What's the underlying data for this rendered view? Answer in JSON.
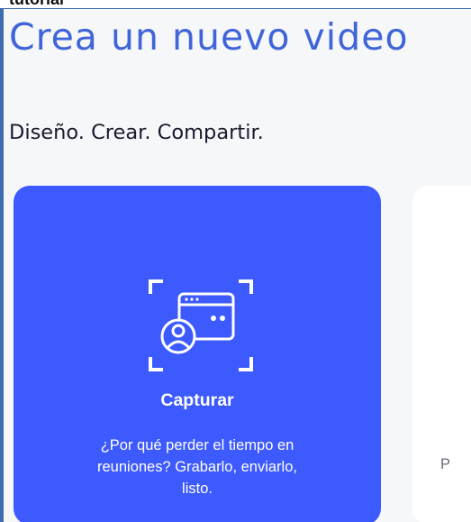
{
  "top_strip": {
    "text": "tutorial"
  },
  "header": {
    "title": "Crea un nuevo video",
    "subtitle": "Diseño. Crear. Compartir."
  },
  "cards": [
    {
      "icon": "capture-screen-icon",
      "title": "Capturar",
      "description_lines": [
        "¿Por qué perder el tiempo en",
        "reuniones? Grabarlo, enviarlo,",
        "listo."
      ],
      "background": "#3d5afe"
    },
    {
      "partial_text": "P",
      "background": "#ffffff"
    }
  ],
  "colors": {
    "title": "#3f65d8",
    "frame_border": "#3d6db0",
    "background": "#f6f7f9",
    "accent": "#3d5afe"
  }
}
